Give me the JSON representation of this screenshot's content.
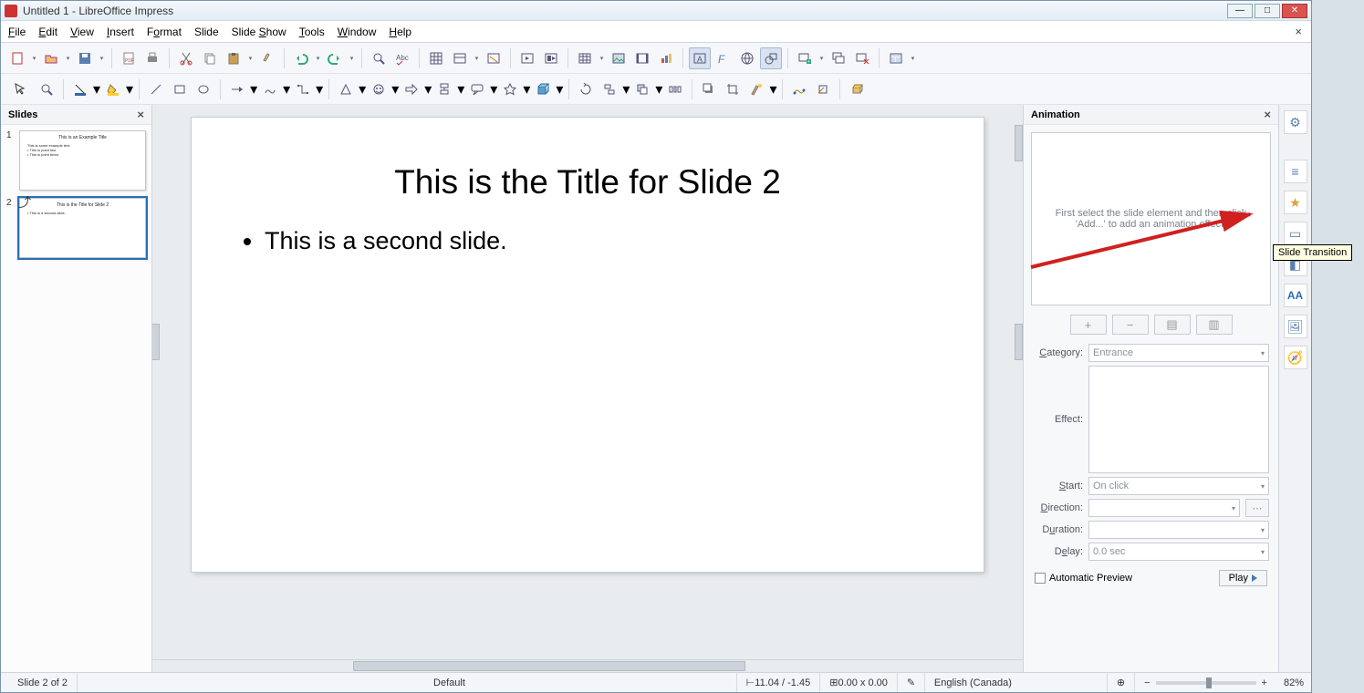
{
  "window": {
    "title": "Untitled 1 - LibreOffice Impress"
  },
  "menubar": [
    {
      "label": "File",
      "u": 0
    },
    {
      "label": "Edit",
      "u": 0
    },
    {
      "label": "View",
      "u": 0
    },
    {
      "label": "Insert",
      "u": 0
    },
    {
      "label": "Format",
      "u": 1
    },
    {
      "label": "Slide",
      "u": -1
    },
    {
      "label": "Slide Show",
      "u": 6
    },
    {
      "label": "Tools",
      "u": 0
    },
    {
      "label": "Window",
      "u": 0
    },
    {
      "label": "Help",
      "u": 0
    }
  ],
  "panels": {
    "slides_header": "Slides",
    "animation_header": "Animation"
  },
  "slides": [
    {
      "num": "1",
      "title": "This is an Example Title",
      "lines": [
        "This is some example text.",
        "• This is point two.",
        "• This is point three."
      ]
    },
    {
      "num": "2",
      "title": "This is the Title for Slide 2",
      "lines": [
        "• This is a second slide."
      ]
    }
  ],
  "current_slide": {
    "title": "This is the Title for Slide 2",
    "bullet1": "This is a second slide."
  },
  "animation": {
    "hint": "First select the slide element and then click 'Add...' to add an animation effect.",
    "category_label": "Category:",
    "category_value": "Entrance",
    "effect_label": "Effect:",
    "start_label": "Start:",
    "start_value": "On click",
    "direction_label": "Direction:",
    "duration_label": "Duration:",
    "delay_label": "Delay:",
    "delay_value": "0.0 sec",
    "auto_preview": "Automatic Preview",
    "play": "Play"
  },
  "tooltip": "Slide Transition",
  "statusbar": {
    "slide_count": "Slide 2 of 2",
    "master": "Default",
    "pos": "11.04 / -1.45",
    "size": "0.00 x 0.00",
    "lang": "English (Canada)",
    "zoom": "82%"
  }
}
